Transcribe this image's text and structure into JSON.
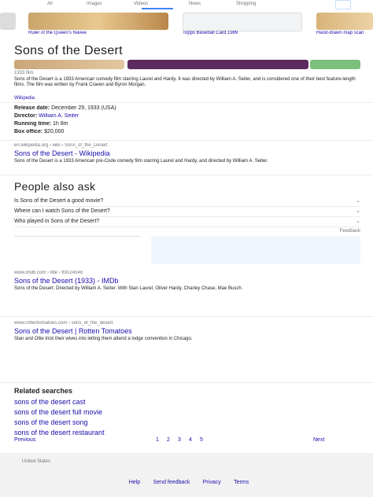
{
  "header": {
    "tabs": [
      "All",
      "Images",
      "Videos",
      "News",
      "Shopping"
    ],
    "colors": {
      "accent": "#1a73e8",
      "link": "#1a0dab",
      "visited": "#681da8",
      "gray": "#70757a"
    }
  },
  "top_images": {
    "captions": [
      "Ruler of the Queen's Navee",
      "Topps Baseball Card 1989",
      "Hand-drawn map scan"
    ]
  },
  "entity": {
    "title": "Sons of the Desert",
    "thumbs_caption": "1933 film",
    "description": "Sons of the Desert is a 1933 American comedy film starring Laurel and Hardy. It was directed by William A. Seiter, and is considered one of their best feature-length films. The film was written by Frank Craven and Byron Morgan.",
    "source": "Wikipedia",
    "facts": [
      {
        "label": "Release date:",
        "value": "December 29, 1933 (USA)"
      },
      {
        "label": "Director:",
        "value": "William A. Seiter"
      },
      {
        "label": "Running time:",
        "value": "1h 8m"
      },
      {
        "label": "Box office:",
        "value": "$20,000"
      }
    ]
  },
  "result_1": {
    "url": "en.wikipedia.org › wiki › Sons_of_the_Desert",
    "title": "Sons of the Desert - Wikipedia",
    "snippet": "Sons of the Desert is a 1933 American pre-Code comedy film starring Laurel and Hardy, and directed by William A. Seiter."
  },
  "paa": {
    "heading": "People also ask",
    "questions": [
      "Is Sons of the Desert a good movie?",
      "Where can I watch Sons of the Desert?",
      "Who played in Sons of the Desert?"
    ],
    "feedback": "Feedback"
  },
  "result_2": {
    "url": "www.imdb.com › title › tt0024548",
    "title": "Sons of the Desert (1933) - IMDb",
    "snippet": "Sons of the Desert: Directed by William A. Seiter. With Stan Laurel, Oliver Hardy, Charley Chase, Mae Busch."
  },
  "result_3": {
    "url": "www.rottentomatoes.com › sons_of_the_desert",
    "title": "Sons of the Desert | Rotten Tomatoes",
    "snippet": "Stan and Ollie trick their wives into letting them attend a lodge convention in Chicago."
  },
  "related": {
    "heading": "Related searches",
    "items": [
      "sons of the desert cast",
      "sons of the desert full movie",
      "sons of the desert song",
      "sons of the desert restaurant"
    ]
  },
  "pagination": {
    "prev": "Previous",
    "next": "Next",
    "pages": [
      "1",
      "2",
      "3",
      "4",
      "5"
    ]
  },
  "footer": {
    "location": "United States",
    "links": [
      "Help",
      "Send feedback",
      "Privacy",
      "Terms"
    ]
  }
}
